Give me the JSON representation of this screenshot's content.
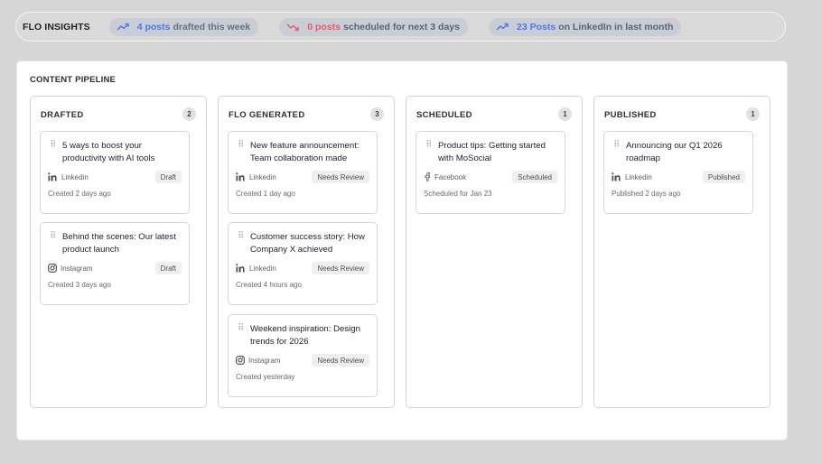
{
  "insights": {
    "title": "FLO INSIGHTS",
    "pills": [
      {
        "icon": "trending-up-icon",
        "highlight": "4 posts",
        "text": "drafted this week",
        "accent": "#4f76e8"
      },
      {
        "icon": "trending-down-icon",
        "highlight": "0 posts",
        "text": "scheduled for next 3 days",
        "accent": "#e85a64"
      },
      {
        "icon": "trending-up-icon",
        "highlight": "23 Posts",
        "text": "on LinkedIn in last month",
        "accent": "#4f76e8"
      }
    ]
  },
  "pipeline": {
    "title": "CONTENT PIPELINE",
    "columns": [
      {
        "name": "DRAFTED",
        "count": "2",
        "cards": [
          {
            "title": "5 ways to boost your productivity with AI tools",
            "platform": "Linkedin",
            "platform_icon": "linkedin-icon",
            "status": "Draft",
            "meta": "Created 2 days ago"
          },
          {
            "title": "Behind the scenes: Our latest product launch",
            "platform": "Instagram",
            "platform_icon": "instagram-icon",
            "status": "Draft",
            "meta": "Created 3 days ago"
          }
        ]
      },
      {
        "name": "FLO GENERATED",
        "count": "3",
        "cards": [
          {
            "title": "New feature announcement: Team collaboration made",
            "platform": "Linkedin",
            "platform_icon": "linkedin-icon",
            "status": "Needs Review",
            "meta": "Created 1 day ago"
          },
          {
            "title": "Customer success story: How Company X achieved",
            "platform": "Linkedin",
            "platform_icon": "linkedin-icon",
            "status": "Needs Review",
            "meta": "Created 4 hours ago"
          },
          {
            "title": "Weekend inspiration: Design trends for 2026",
            "platform": "Instagram",
            "platform_icon": "instagram-icon",
            "status": "Needs Review",
            "meta": "Created yesterday"
          }
        ]
      },
      {
        "name": "SCHEDULED",
        "count": "1",
        "cards": [
          {
            "title": "Product tips: Getting started with MoSocial",
            "platform": "Facebook",
            "platform_icon": "facebook-icon",
            "status": "Scheduled",
            "meta": "Scheduled for Jan 23"
          }
        ]
      },
      {
        "name": "PUBLISHED",
        "count": "1",
        "cards": [
          {
            "title": "Announcing our Q1 2026 roadmap",
            "platform": "Linkedin",
            "platform_icon": "linkedin-icon",
            "status": "Published",
            "meta": "Published 2 days ago"
          }
        ]
      }
    ]
  }
}
